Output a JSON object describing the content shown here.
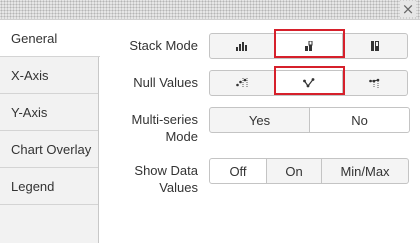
{
  "titlebar": {
    "close_label": "×"
  },
  "sidebar": {
    "tabs": [
      {
        "label": "General"
      },
      {
        "label": "X-Axis"
      },
      {
        "label": "Y-Axis"
      },
      {
        "label": "Chart Overlay"
      },
      {
        "label": "Legend"
      }
    ]
  },
  "general": {
    "stack_mode": {
      "label": "Stack Mode",
      "options": [
        "stack-off-icon",
        "stack-on-icon",
        "stack-100-icon"
      ],
      "selected": 1
    },
    "null_values": {
      "label": "Null Values",
      "options": [
        "null-gaps-icon",
        "null-connect-icon",
        "null-zero-icon"
      ],
      "selected": 1
    },
    "multi_series": {
      "label_line1": "Multi-series",
      "label_line2": "Mode",
      "yes": "Yes",
      "no": "No"
    },
    "show_data_values": {
      "label_line1": "Show Data",
      "label_line2": "Values",
      "off": "Off",
      "on": "On",
      "minmax": "Min/Max"
    }
  },
  "colors": {
    "highlight": "#d6202b",
    "panel_bg": "#f2f2f2",
    "button_bg": "#f4f4f4"
  }
}
